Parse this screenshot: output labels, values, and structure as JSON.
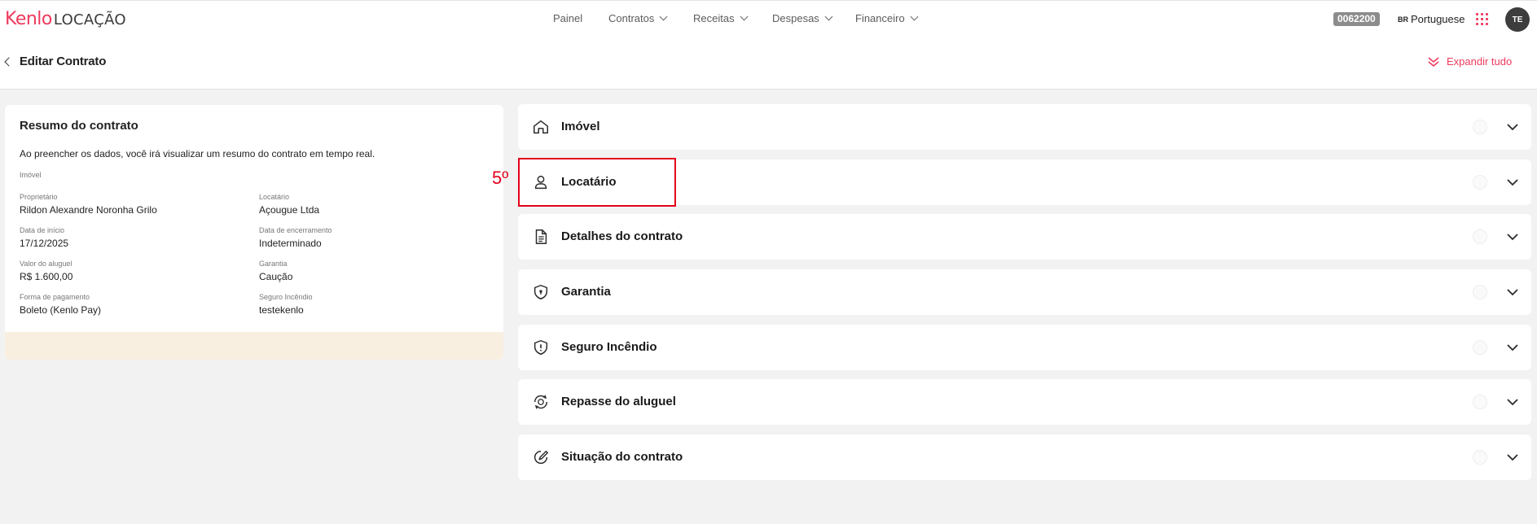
{
  "brand": {
    "name": "Kenlo",
    "product": "LOCAÇÃO",
    "accent": "#ef3a5d"
  },
  "nav": {
    "items": [
      {
        "label": "Painel"
      },
      {
        "label": "Contratos"
      },
      {
        "label": "Receitas"
      },
      {
        "label": "Despesas"
      },
      {
        "label": "Financeiro"
      }
    ]
  },
  "account": {
    "code": "0062200",
    "language_flag": "BR",
    "language": "Portuguese",
    "avatar_initials": "TE"
  },
  "page": {
    "title": "Editar Contrato",
    "expand_label": "Expandir tudo"
  },
  "summary": {
    "title": "Resumo do contrato",
    "description": "Ao preencher os dados, você irá visualizar um resumo do contrato em tempo real.",
    "imovel_label": "Imóvel",
    "fields": [
      {
        "label": "Proprietário",
        "value": "Rildon Alexandre Noronha Grilo"
      },
      {
        "label": "Locatário",
        "value": "Açougue Ltda"
      },
      {
        "label": "Data de início",
        "value": "17/12/2025"
      },
      {
        "label": "Data de encerramento",
        "value": "Indeterminado"
      },
      {
        "label": "Valor do aluguel",
        "value": "R$ 1.600,00"
      },
      {
        "label": "Garantia",
        "value": "Caução"
      },
      {
        "label": "Forma de pagamento",
        "value": "Boleto (Kenlo Pay)"
      },
      {
        "label": "Seguro Incêndio",
        "value": "testekenlo"
      }
    ]
  },
  "sections": [
    {
      "label": "Imóvel",
      "icon": "home-icon"
    },
    {
      "label": "Locatário",
      "icon": "user-icon"
    },
    {
      "label": "Detalhes do contrato",
      "icon": "document-icon"
    },
    {
      "label": "Garantia",
      "icon": "shield-lock-icon"
    },
    {
      "label": "Seguro Incêndio",
      "icon": "shield-alert-icon"
    },
    {
      "label": "Repasse do aluguel",
      "icon": "money-transfer-icon"
    },
    {
      "label": "Situação do contrato",
      "icon": "edit-circle-icon"
    }
  ],
  "annotation": {
    "step": "5º",
    "color": "#e3001b"
  }
}
